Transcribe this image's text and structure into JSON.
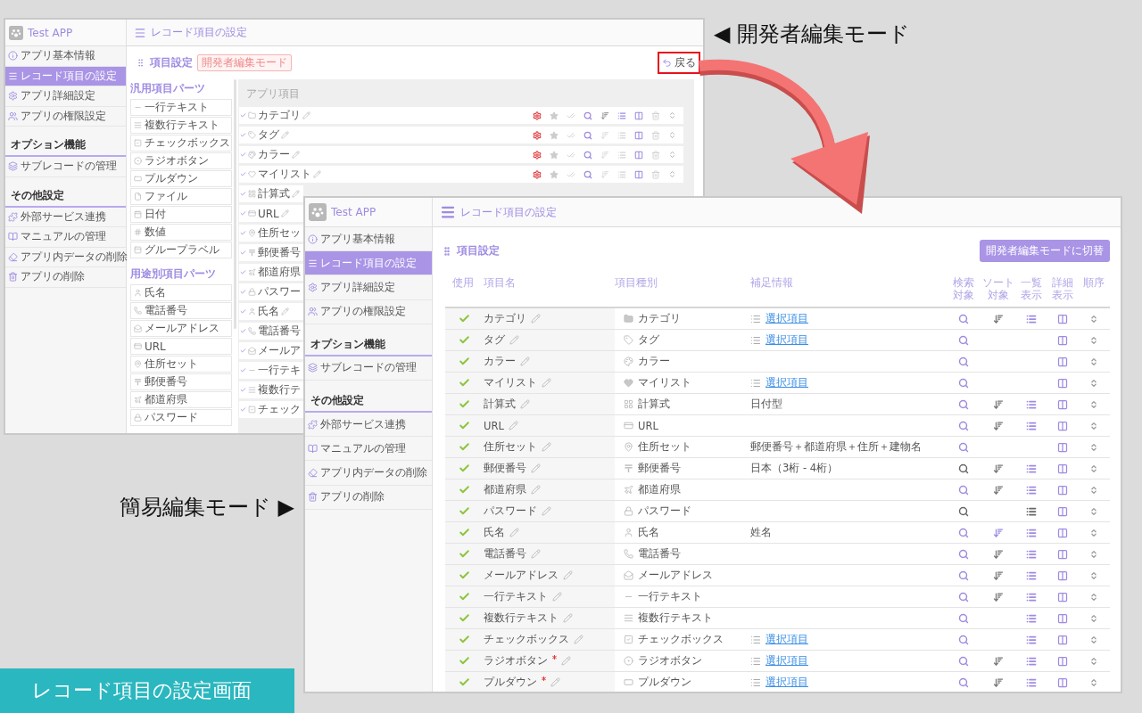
{
  "developer_window": {
    "app_name": "Test APP",
    "header_title": "レコード項目の設定",
    "sidebar": [
      {
        "kind": "item",
        "label": "アプリ基本情報",
        "selected": false
      },
      {
        "kind": "item",
        "label": "レコード項目の設定",
        "selected": true
      },
      {
        "kind": "item",
        "label": "アプリ詳細設定",
        "selected": false
      },
      {
        "kind": "item",
        "label": "アプリの権限設定",
        "selected": false
      },
      {
        "kind": "section",
        "label": "オプション機能"
      },
      {
        "kind": "item",
        "label": "サブレコードの管理",
        "selected": false
      },
      {
        "kind": "section",
        "label": "その他設定"
      },
      {
        "kind": "item",
        "label": "外部サービス連携",
        "selected": false
      },
      {
        "kind": "item",
        "label": "マニュアルの管理",
        "selected": false
      },
      {
        "kind": "item",
        "label": "アプリ内データの削除",
        "selected": false
      },
      {
        "kind": "item",
        "label": "アプリの削除",
        "selected": false
      }
    ],
    "heading": "項目設定",
    "mode_badge": "開発者編集モード",
    "back_button": "戻る",
    "palette": [
      {
        "title": "汎用項目パーツ",
        "items": [
          {
            "label": "一行テキスト",
            "kind": "singleline"
          },
          {
            "label": "複数行テキスト",
            "kind": "multiline"
          },
          {
            "label": "チェックボックス",
            "kind": "checkbox"
          },
          {
            "label": "ラジオボタン",
            "kind": "radio"
          },
          {
            "label": "プルダウン",
            "kind": "pulldown"
          },
          {
            "label": "ファイル",
            "kind": "file"
          },
          {
            "label": "日付",
            "kind": "date"
          },
          {
            "label": "数値",
            "kind": "number"
          },
          {
            "label": "グループラベル",
            "kind": "grouplabel"
          }
        ]
      },
      {
        "title": "用途別項目パーツ",
        "items": [
          {
            "label": "氏名",
            "kind": "name"
          },
          {
            "label": "電話番号",
            "kind": "phone"
          },
          {
            "label": "メールアドレス",
            "kind": "email"
          },
          {
            "label": "URL",
            "kind": "url"
          },
          {
            "label": "住所セット",
            "kind": "address"
          },
          {
            "label": "郵便番号",
            "kind": "postal"
          },
          {
            "label": "都道府県",
            "kind": "prefecture"
          },
          {
            "label": "パスワード",
            "kind": "password"
          }
        ]
      }
    ],
    "app_items_title": "アプリ項目",
    "app_items": [
      {
        "label": "カテゴリ",
        "kind": "category",
        "editable": true,
        "tools": {
          "sort": true,
          "list": true
        }
      },
      {
        "label": "タグ",
        "kind": "tag",
        "editable": true,
        "tools": {
          "sort": false,
          "list": false
        }
      },
      {
        "label": "カラー",
        "kind": "color",
        "editable": true,
        "tools": {
          "sort": false,
          "list": false
        }
      },
      {
        "label": "マイリスト",
        "kind": "mylist",
        "editable": true,
        "tools": {
          "sort": false,
          "list": false
        }
      },
      {
        "label": "計算式",
        "kind": "formula",
        "editable": true
      },
      {
        "label": "URL",
        "kind": "url",
        "editable": true
      },
      {
        "label": "住所セッ",
        "kind": "address",
        "editable": false
      },
      {
        "label": "郵便番号",
        "kind": "postal",
        "editable": false
      },
      {
        "label": "都道府県",
        "kind": "prefecture",
        "editable": false
      },
      {
        "label": "パスワー",
        "kind": "password",
        "editable": false
      },
      {
        "label": "氏名",
        "kind": "name",
        "editable": true
      },
      {
        "label": "電話番号",
        "kind": "phone",
        "editable": false
      },
      {
        "label": "メールア",
        "kind": "email",
        "editable": false
      },
      {
        "label": "一行テキ",
        "kind": "singleline",
        "editable": false
      },
      {
        "label": "複数行テ",
        "kind": "multiline",
        "editable": false
      },
      {
        "label": "チェック",
        "kind": "checkbox",
        "editable": false
      }
    ]
  },
  "developer_label": "◀ 開発者編集モード",
  "simple_window": {
    "app_name": "Test APP",
    "header_title": "レコード項目の設定",
    "sidebar": [
      {
        "kind": "item",
        "label": "アプリ基本情報",
        "selected": false
      },
      {
        "kind": "item",
        "label": "レコード項目の設定",
        "selected": true
      },
      {
        "kind": "item",
        "label": "アプリ詳細設定",
        "selected": false
      },
      {
        "kind": "item",
        "label": "アプリの権限設定",
        "selected": false
      },
      {
        "kind": "section",
        "label": "オプション機能"
      },
      {
        "kind": "item",
        "label": "サブレコードの管理",
        "selected": false
      },
      {
        "kind": "section",
        "label": "その他設定"
      },
      {
        "kind": "item",
        "label": "外部サービス連携",
        "selected": false
      },
      {
        "kind": "item",
        "label": "マニュアルの管理",
        "selected": false
      },
      {
        "kind": "item",
        "label": "アプリ内データの削除",
        "selected": false
      },
      {
        "kind": "item",
        "label": "アプリの削除",
        "selected": false
      }
    ],
    "heading": "項目設定",
    "switch_button": "開発者編集モードに切替",
    "columns": [
      "使用",
      "項目名",
      "項目種別",
      "補足情報",
      "検索対象",
      "ソート対象",
      "一覧表示",
      "詳細表示",
      "順序"
    ],
    "rows": [
      {
        "used": true,
        "name": "カテゴリ",
        "required": false,
        "kind": "category",
        "type_label": "カテゴリ",
        "info": {
          "kind": "link",
          "text": "選択項目"
        },
        "search_active": true,
        "sort_shown": true,
        "sort_active": false,
        "list_shown": true,
        "list_active": true
      },
      {
        "used": true,
        "name": "タグ",
        "required": false,
        "kind": "tag",
        "type_label": "タグ",
        "info": {
          "kind": "link",
          "text": "選択項目"
        },
        "search_active": true,
        "sort_shown": false,
        "list_shown": false
      },
      {
        "used": true,
        "name": "カラー",
        "required": false,
        "kind": "color",
        "type_label": "カラー",
        "search_active": true,
        "sort_shown": false,
        "list_shown": false
      },
      {
        "used": true,
        "name": "マイリスト",
        "required": false,
        "kind": "mylist",
        "type_label": "マイリスト",
        "info": {
          "kind": "link",
          "text": "選択項目"
        },
        "search_active": true,
        "sort_shown": false,
        "list_shown": false
      },
      {
        "used": true,
        "name": "計算式",
        "required": false,
        "kind": "formula",
        "type_label": "計算式",
        "info": {
          "kind": "text",
          "text": "日付型"
        },
        "search_active": true,
        "sort_shown": true,
        "sort_active": false,
        "list_shown": true,
        "list_active": true
      },
      {
        "used": true,
        "name": "URL",
        "required": false,
        "kind": "url",
        "type_label": "URL",
        "search_active": true,
        "sort_shown": true,
        "sort_active": false,
        "list_shown": true,
        "list_active": true
      },
      {
        "used": true,
        "name": "住所セット",
        "required": false,
        "kind": "address",
        "type_label": "住所セット",
        "info": {
          "kind": "text",
          "text": "郵便番号＋都道府県＋住所＋建物名"
        },
        "search_active": true,
        "sort_shown": false,
        "list_shown": false
      },
      {
        "used": true,
        "name": "郵便番号",
        "required": false,
        "kind": "postal",
        "type_label": "郵便番号",
        "info": {
          "kind": "text",
          "text": "日本（3桁 - 4桁）"
        },
        "search_active": false,
        "sort_shown": true,
        "sort_active": false,
        "list_shown": true,
        "list_active": true
      },
      {
        "used": true,
        "name": "都道府県",
        "required": false,
        "kind": "prefecture",
        "type_label": "都道府県",
        "search_active": true,
        "sort_shown": true,
        "sort_active": false,
        "list_shown": true,
        "list_active": true
      },
      {
        "used": true,
        "name": "パスワード",
        "required": false,
        "kind": "password",
        "type_label": "パスワード",
        "search_active": false,
        "sort_shown": false,
        "list_shown": true,
        "list_active": false
      },
      {
        "used": true,
        "name": "氏名",
        "required": false,
        "kind": "name",
        "type_label": "氏名",
        "info": {
          "kind": "text",
          "text": "姓名"
        },
        "search_active": true,
        "sort_shown": true,
        "sort_active": true,
        "list_shown": true,
        "list_active": true
      },
      {
        "used": true,
        "name": "電話番号",
        "required": false,
        "kind": "phone",
        "type_label": "電話番号",
        "search_active": true,
        "sort_shown": true,
        "sort_active": false,
        "list_shown": true,
        "list_active": true
      },
      {
        "used": true,
        "name": "メールアドレス",
        "required": false,
        "kind": "email",
        "type_label": "メールアドレス",
        "search_active": true,
        "sort_shown": true,
        "sort_active": false,
        "list_shown": true,
        "list_active": true
      },
      {
        "used": true,
        "name": "一行テキスト",
        "required": false,
        "kind": "singleline",
        "type_label": "一行テキスト",
        "search_active": true,
        "sort_shown": true,
        "sort_active": false,
        "list_shown": true,
        "list_active": true
      },
      {
        "used": true,
        "name": "複数行テキスト",
        "required": false,
        "kind": "multiline",
        "type_label": "複数行テキスト",
        "search_active": true,
        "sort_shown": false,
        "list_shown": true,
        "list_active": true
      },
      {
        "used": true,
        "name": "チェックボックス",
        "required": false,
        "kind": "checkbox",
        "type_label": "チェックボックス",
        "info": {
          "kind": "link",
          "text": "選択項目"
        },
        "search_active": true,
        "sort_shown": false,
        "list_shown": true,
        "list_active": true
      },
      {
        "used": true,
        "name": "ラジオボタン",
        "required": true,
        "kind": "radio",
        "type_label": "ラジオボタン",
        "info": {
          "kind": "link",
          "text": "選択項目"
        },
        "search_active": true,
        "sort_shown": true,
        "sort_active": false,
        "list_shown": true,
        "list_active": true
      },
      {
        "used": true,
        "name": "プルダウン",
        "required": true,
        "kind": "pulldown",
        "type_label": "プルダウン",
        "info": {
          "kind": "link",
          "text": "選択項目"
        },
        "search_active": true,
        "sort_shown": true,
        "sort_active": false,
        "list_shown": true,
        "list_active": true
      }
    ]
  },
  "simple_label": "簡易編集モード ▶",
  "caption": "レコード項目の設定画面"
}
